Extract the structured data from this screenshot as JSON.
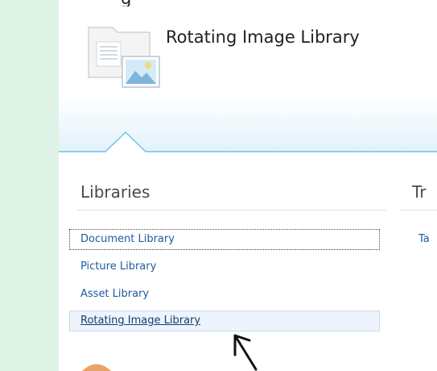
{
  "header": {
    "top_clipped_text": "g",
    "title": "Rotating Image Library"
  },
  "libraries": {
    "title": "Libraries",
    "items": [
      {
        "label": "Document Library"
      },
      {
        "label": "Picture Library"
      },
      {
        "label": "Asset Library"
      },
      {
        "label": "Rotating Image Library"
      }
    ]
  },
  "second_section": {
    "title_visible": "Tr",
    "link_visible": "Ta"
  },
  "icons": {
    "hero": "image-library-icon",
    "cursor": "mouse-pointer-icon"
  },
  "colors": {
    "left_bar": "#dff2e6",
    "link": "#1f5aa0",
    "band_line": "#6fc3e8"
  }
}
